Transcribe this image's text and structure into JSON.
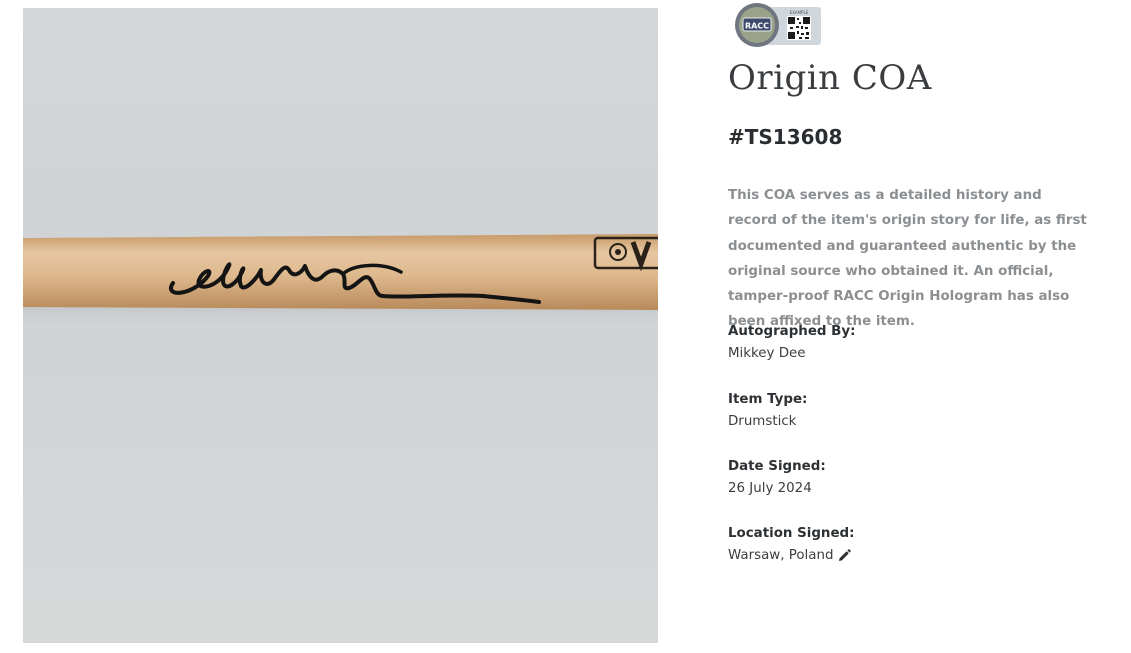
{
  "coa": {
    "title": "Origin COA",
    "certificate_number": "#TS13608",
    "description": "This COA serves as a detailed history and record of the item's origin story for life, as first documented and guaranteed authentic by the original source who obtained it. An official, tamper-proof RACC Origin Hologram has also been affixed to the item."
  },
  "badge": {
    "logo_text": "RACC",
    "qr_caption": "EXAMPLE"
  },
  "fields": [
    {
      "label": "Autographed By:",
      "value": "Mikkey Dee"
    },
    {
      "label": "Item Type:",
      "value": "Drumstick"
    },
    {
      "label": "Date Signed:",
      "value": "26 July 2024"
    },
    {
      "label": "Location Signed:",
      "value": "Warsaw, Poland",
      "icon": "pencil-icon"
    }
  ],
  "colors": {
    "title": "#3a3d40",
    "description": "#8c8f92",
    "label": "#2e3134"
  }
}
